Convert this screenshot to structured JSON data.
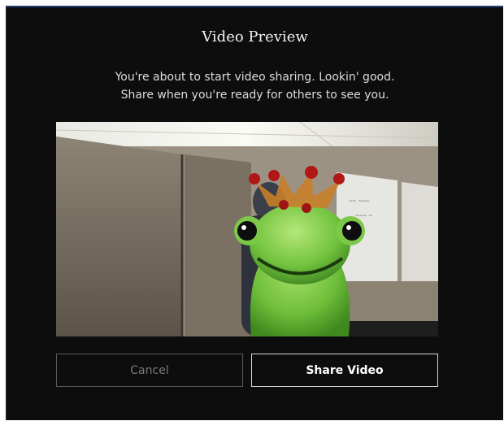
{
  "dialog": {
    "title": "Video Preview",
    "message_line1": "You're about to start video sharing. Lookin' good.",
    "message_line2": "Share when you're ready for others to see you."
  },
  "video_preview": {
    "subject": "glass frog with crown figurine in office"
  },
  "buttons": {
    "cancel_label": "Cancel",
    "share_label": "Share Video"
  },
  "colors": {
    "dialog_background": "#0d0d0d",
    "top_border": "#1f3c73"
  }
}
